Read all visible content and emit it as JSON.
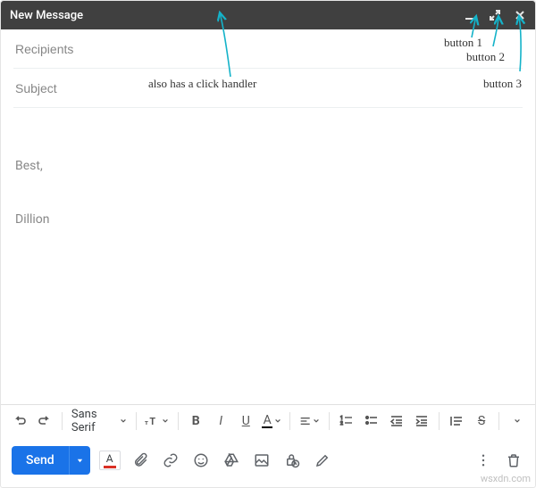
{
  "titlebar": {
    "title": "New Message"
  },
  "fields": {
    "recipients_placeholder": "Recipients",
    "subject_placeholder": "Subject"
  },
  "body": {
    "signature_line1": "Best,",
    "signature_line2": "Dillion"
  },
  "toolbar": {
    "font_family": "Sans Serif",
    "bold": "B",
    "italic": "I",
    "underline": "U",
    "text_color_letter": "A",
    "strike": "S"
  },
  "bottom": {
    "send_label": "Send",
    "text_format_letter": "A"
  },
  "annotations": {
    "also_click": "also has a click handler",
    "btn1": "button 1",
    "btn2": "button 2",
    "btn3": "button 3"
  },
  "watermark": "wsxdn.com"
}
